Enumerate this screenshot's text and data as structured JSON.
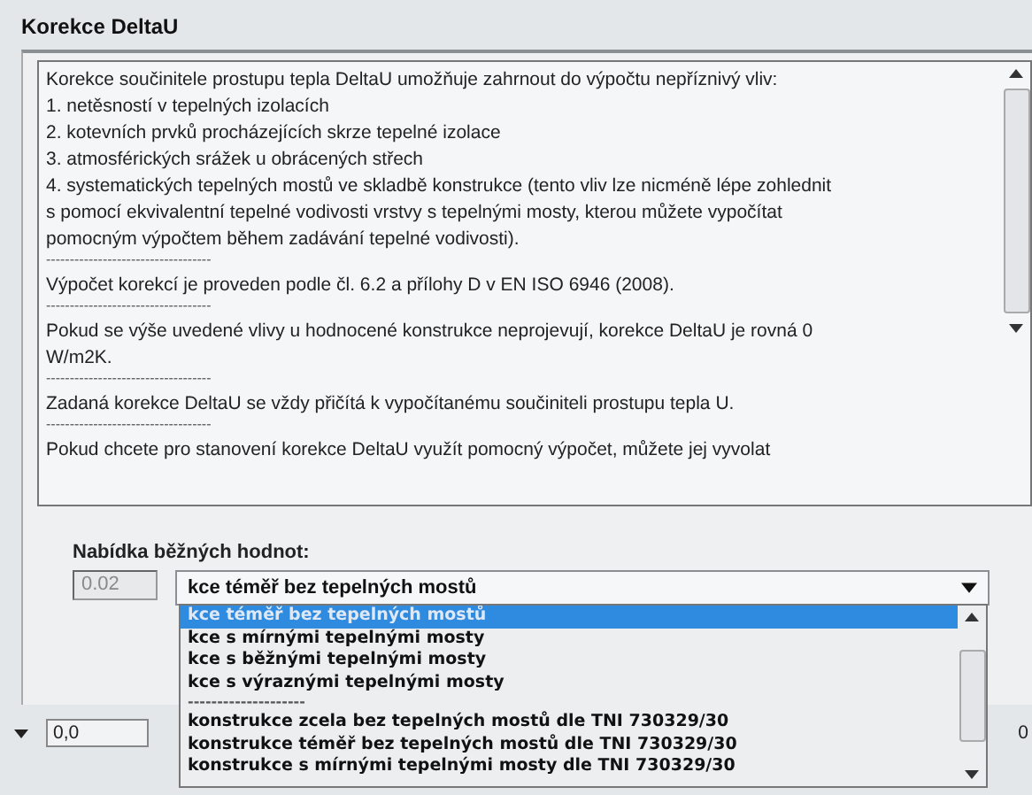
{
  "title": "Korekce DeltaU",
  "info_lines": [
    {
      "kind": "text",
      "text": "Korekce součinitele prostupu tepla DeltaU umožňuje zahrnout do výpočtu nepříznivý vliv:"
    },
    {
      "kind": "text",
      "text": "1. netěsností v tepelných izolacích"
    },
    {
      "kind": "text",
      "text": "2. kotevních prvků procházejících skrze tepelné izolace"
    },
    {
      "kind": "text",
      "text": "3. atmosférických srážek u obrácených střech"
    },
    {
      "kind": "text",
      "text": "4. systematických tepelných mostů ve skladbě konstrukce (tento vliv lze nicméně lépe zohlednit"
    },
    {
      "kind": "text",
      "text": "s pomocí ekvivalentní tepelné vodivosti vrstvy s tepelnými mosty, kterou můžete vypočítat"
    },
    {
      "kind": "text",
      "text": "pomocným výpočtem během zadávání tepelné vodivosti)."
    },
    {
      "kind": "separator",
      "text": "-----------------------------------"
    },
    {
      "kind": "text",
      "text": "Výpočet korekcí je proveden podle čl. 6.2 a přílohy D v EN ISO 6946 (2008)."
    },
    {
      "kind": "separator",
      "text": "-----------------------------------"
    },
    {
      "kind": "text",
      "text": "Pokud se výše uvedené vlivy u hodnocené konstrukce neprojevují, korekce DeltaU je rovná 0"
    },
    {
      "kind": "text",
      "text": "W/m2K."
    },
    {
      "kind": "separator",
      "text": "-----------------------------------"
    },
    {
      "kind": "text",
      "text": "Zadaná korekce DeltaU se vždy přičítá k vypočítanému součiniteli prostupu tepla U."
    },
    {
      "kind": "separator",
      "text": "-----------------------------------"
    },
    {
      "kind": "text",
      "text": "Pokud chcete pro stanovení korekce DeltaU využít pomocný výpočet,  můžete jej vyvolat"
    }
  ],
  "offer_label": "Nabídka běžných hodnot:",
  "value_field": {
    "value": "0.02",
    "disabled": true
  },
  "combo": {
    "value": "kce téměř bez tepelných mostů",
    "expanded": true
  },
  "options": [
    {
      "kind": "option",
      "text": "kce téměř bez tepelných mostů",
      "selected": true
    },
    {
      "kind": "option",
      "text": "kce s mírnými tepelnými mosty",
      "selected": false
    },
    {
      "kind": "option",
      "text": "kce s běžnými tepelnými mosty",
      "selected": false
    },
    {
      "kind": "option",
      "text": "kce s výraznými tepelnými mosty",
      "selected": false
    },
    {
      "kind": "separator",
      "text": "--------------------"
    },
    {
      "kind": "option",
      "text": "konstrukce zcela bez tepelných mostů dle TNI 730329/30",
      "selected": false
    },
    {
      "kind": "option",
      "text": "konstrukce téměř bez tepelných mostů dle TNI 730329/30",
      "selected": false
    },
    {
      "kind": "option",
      "text": "konstrukce s mírnými tepelnými mosty dle TNI 730329/30",
      "selected": false
    }
  ],
  "background": {
    "field_value": "0,0",
    "edge_text": "0"
  }
}
